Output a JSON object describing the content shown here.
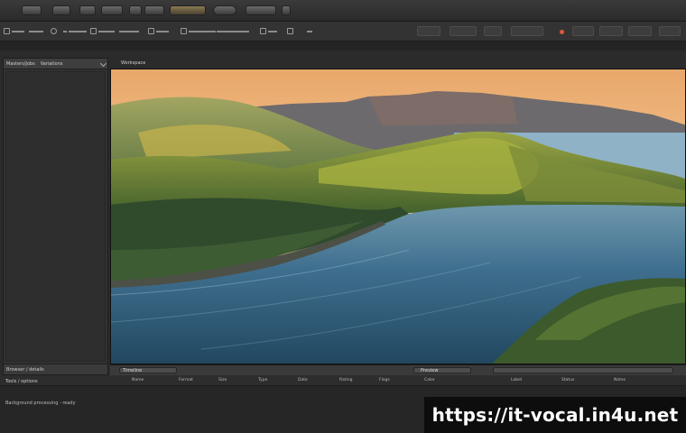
{
  "toolbar": {
    "top_buttons": [
      "app-btn-1",
      "app-btn-2",
      "app-btn-3",
      "app-btn-4",
      "app-btn-5",
      "app-btn-6",
      "app-btn-7",
      "app-btn-8",
      "app-btn-9"
    ]
  },
  "left_panel": {
    "tab_1": "Masters/Jobs",
    "tab_2": "Variations",
    "footer": "Browser / details"
  },
  "viewer": {
    "label": "Workspace"
  },
  "timeline": {
    "left_label": "Timeline",
    "right_label": "Preview"
  },
  "bottom": {
    "title": "Tools / options",
    "status": "Background processing - ready",
    "columns": [
      "Name",
      "Format",
      "Size",
      "Type",
      "Date",
      "Rating",
      "Flags",
      "Color",
      "Label",
      "Status",
      "Notes"
    ]
  },
  "watermark": {
    "text": "https://it-vocal.in4u.net"
  },
  "colors": {
    "accent_record": "#d85a3c",
    "background": "#2b2b2b"
  }
}
